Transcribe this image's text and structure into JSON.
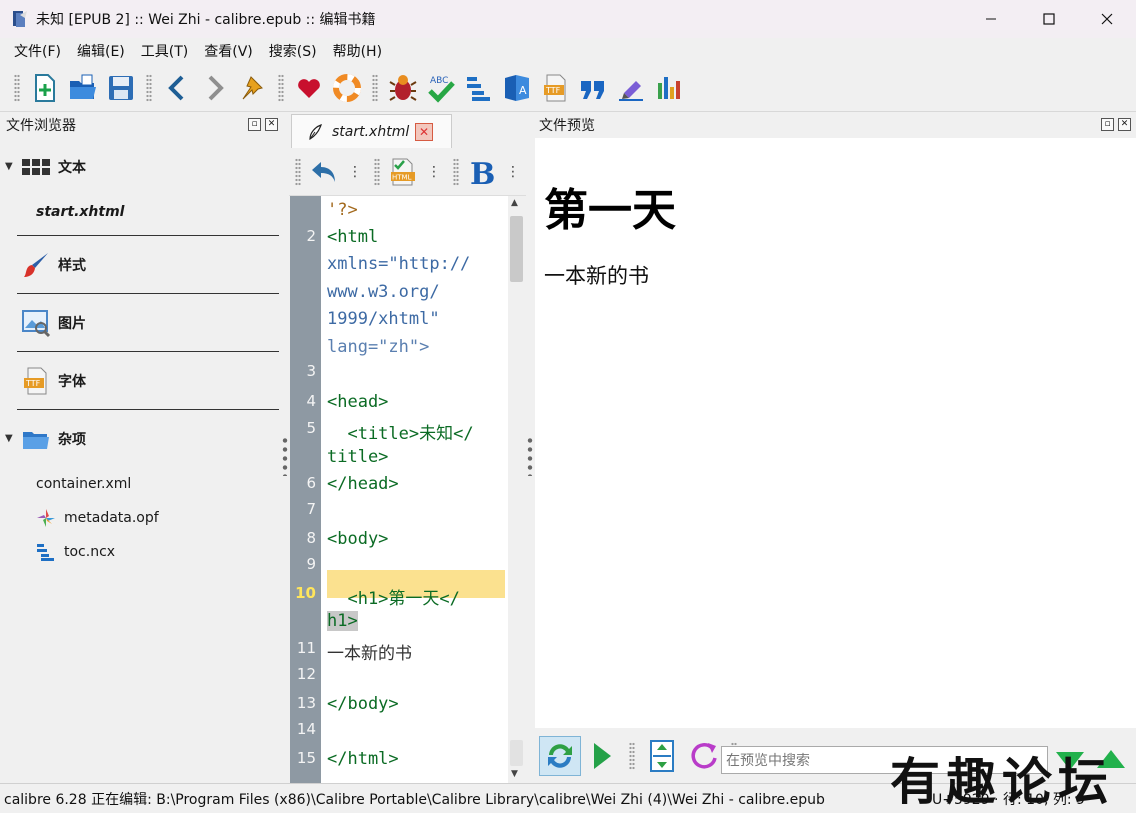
{
  "window": {
    "title": "未知 [EPUB 2] :: Wei Zhi - calibre.epub :: 编辑书籍",
    "controls": [
      "minimize-icon",
      "maximize-icon",
      "close-icon"
    ]
  },
  "menubar": {
    "items": [
      "文件(F)",
      "编辑(E)",
      "工具(T)",
      "查看(V)",
      "搜索(S)",
      "帮助(H)"
    ]
  },
  "toolbar": {
    "icons": [
      "new-file-icon",
      "open-book-icon",
      "save-icon",
      "back-icon",
      "forward-icon",
      "checkpoint-pin-icon",
      "donate-heart-icon",
      "help-lifebuoy-icon",
      "check-book-bug-icon",
      "spell-check-icon",
      "table-of-contents-icon",
      "translate-icon",
      "font-ttf-icon",
      "quotes-icon",
      "edit-metadata-icon",
      "reports-icon"
    ]
  },
  "file_browser": {
    "title": "文件浏览器",
    "categories": [
      {
        "label": "文本",
        "icon": "text-files-icon",
        "expanded": true,
        "files": [
          {
            "name": "start.xhtml",
            "current": true
          }
        ]
      },
      {
        "label": "样式",
        "icon": "styles-brush-icon"
      },
      {
        "label": "图片",
        "icon": "images-icon"
      },
      {
        "label": "字体",
        "icon": "fonts-icon"
      },
      {
        "label": "杂项",
        "icon": "misc-folder-icon",
        "expanded": true,
        "files": [
          {
            "name": "container.xml"
          },
          {
            "name": "metadata.opf"
          },
          {
            "name": "toc.ncx"
          }
        ]
      }
    ]
  },
  "editor": {
    "tab_label": "start.xhtml",
    "toolbar_icons": [
      "undo-icon",
      "html-check-icon",
      "bold-icon"
    ],
    "current_line": "10",
    "lines": [
      {
        "num": "",
        "text": "'?>"
      },
      {
        "num": "2",
        "text": "<html"
      },
      {
        "num": "",
        "text": "xmlns=\"http://"
      },
      {
        "num": "",
        "text": "www.w3.org/"
      },
      {
        "num": "",
        "text": "1999/xhtml\""
      },
      {
        "num": "",
        "text": "lang=\"zh\">"
      },
      {
        "num": "3",
        "text": ""
      },
      {
        "num": "4",
        "text": "<head>"
      },
      {
        "num": "5",
        "text": "  <title>未知</"
      },
      {
        "num": "",
        "text": "title>"
      },
      {
        "num": "6",
        "text": "</head>"
      },
      {
        "num": "7",
        "text": ""
      },
      {
        "num": "8",
        "text": "<body>"
      },
      {
        "num": "9",
        "text": ""
      },
      {
        "num": "10",
        "text": "  <h1>第一天</"
      },
      {
        "num": "",
        "text": "h1>"
      },
      {
        "num": "11",
        "text": "一本新的书"
      },
      {
        "num": "12",
        "text": ""
      },
      {
        "num": "13",
        "text": "</body>"
      },
      {
        "num": "14",
        "text": ""
      },
      {
        "num": "15",
        "text": "</html>"
      }
    ]
  },
  "preview": {
    "title": "文件预览",
    "heading": "第一天",
    "paragraph": "一本新的书",
    "search_placeholder": "在预览中搜索",
    "bar_icons": [
      "refresh-sync-icon",
      "play-auto-reload-icon",
      "split-view-icon",
      "reload-icon",
      "search-next-down-icon",
      "search-prev-up-icon"
    ]
  },
  "statusbar": {
    "text": "calibre 6.28 正在编辑: B:\\Program Files (x86)\\Calibre Portable\\Calibre Library\\calibre\\Wei Zhi (4)\\Wei Zhi - calibre.epub",
    "cursor": "U+5929 · 行: 10, 列: 9"
  },
  "watermark": "有趣论坛",
  "colors": {
    "gutter": "#8e99a3",
    "current_line_highlight": "#fbe18f",
    "tag": "#0b6b24",
    "string": "#3d6aa4",
    "title_bar": "#f3eef3"
  }
}
